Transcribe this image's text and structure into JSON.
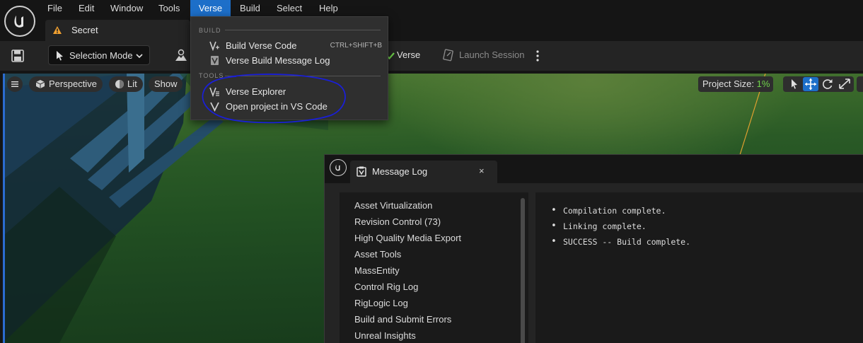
{
  "menubar": {
    "items": [
      {
        "label": "File"
      },
      {
        "label": "Edit"
      },
      {
        "label": "Window"
      },
      {
        "label": "Tools"
      },
      {
        "label": "Verse",
        "active": true
      },
      {
        "label": "Build"
      },
      {
        "label": "Select"
      },
      {
        "label": "Help"
      }
    ]
  },
  "level_tab": {
    "label": "Secret",
    "icon": "level-warning-icon",
    "icon_color": "#f0a030"
  },
  "toolbar": {
    "selection_mode_label": "Selection Mode",
    "verse_label": "Verse",
    "launch_session_label": "Launch Session"
  },
  "viewport": {
    "perspective_label": "Perspective",
    "lit_label": "Lit",
    "show_label": "Show",
    "project_size_label": "Project Size:",
    "project_size_value": "1%",
    "accent_color": "#1d6fc9"
  },
  "verse_menu": {
    "build_section": "BUILD",
    "build_items": [
      {
        "label": "Build Verse Code",
        "shortcut": "CTRL+SHIFT+B",
        "icon": "verse-build-icon"
      },
      {
        "label": "Verse Build Message Log",
        "icon": "message-log-icon"
      }
    ],
    "tools_section": "TOOLS",
    "tools_items": [
      {
        "label": "Verse Explorer",
        "icon": "verse-explorer-icon"
      },
      {
        "label": "Open project in VS Code",
        "icon": "verse-vscode-icon"
      }
    ],
    "annotation_color": "#1a1fd6"
  },
  "message_log": {
    "tab_label": "Message Log",
    "close_label": "×",
    "categories": [
      "Asset Virtualization",
      "Revision Control (73)",
      "High Quality Media Export",
      "Asset Tools",
      "MassEntity",
      "Control Rig Log",
      "RigLogic Log",
      "Build and Submit Errors",
      "Unreal Insights"
    ],
    "messages": [
      "Compilation complete.",
      "Linking complete.",
      "SUCCESS -- Build complete."
    ],
    "bullet": "•"
  }
}
